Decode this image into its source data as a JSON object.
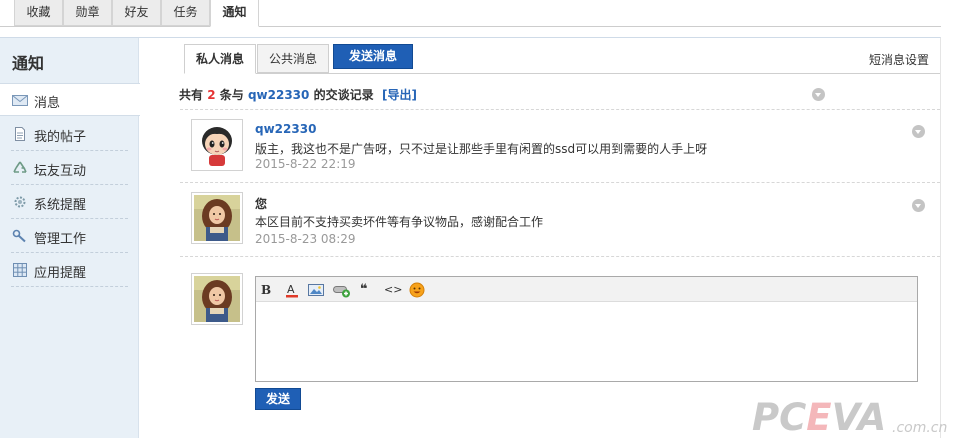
{
  "top_tabs": [
    {
      "label": "收藏"
    },
    {
      "label": "勋章"
    },
    {
      "label": "好友"
    },
    {
      "label": "任务"
    },
    {
      "label": "通知",
      "active": true
    }
  ],
  "sidebar": {
    "title": "通知",
    "items": [
      {
        "label": "消息",
        "icon": "envelope-icon",
        "active": true
      },
      {
        "label": "我的帖子",
        "icon": "document-icon"
      },
      {
        "label": "坛友互动",
        "icon": "recycle-icon"
      },
      {
        "label": "系统提醒",
        "icon": "gear-icon"
      },
      {
        "label": "管理工作",
        "icon": "wrench-icon"
      },
      {
        "label": "应用提醒",
        "icon": "grid-icon"
      }
    ]
  },
  "content_tabs": {
    "private": "私人消息",
    "public": "公共消息",
    "send": "发送消息",
    "settings": "短消息设置"
  },
  "summary": {
    "prefix": "共有",
    "count": "2",
    "middle": "条与",
    "user": "qw22330",
    "suffix": "的交谈记录",
    "export": "[导出]"
  },
  "messages": [
    {
      "name": "qw22330",
      "text": "版主，我这也不是广告呀，只不过是让那些手里有闲置的ssd可以用到需要的人手上呀",
      "time": "2015-8-22 22:19",
      "avatar": "cartoon-boy-avatar"
    },
    {
      "name": "您",
      "text": "本区目前不支持买卖坏件等有争议物品，感谢配合工作",
      "time": "2015-8-23 08:29",
      "avatar": "girl-photo-avatar"
    }
  ],
  "editor": {
    "toolbar": [
      "bold-icon",
      "font-color-icon",
      "image-icon",
      "link-icon",
      "quote-icon",
      "code-icon",
      "smiley-icon"
    ],
    "bold_label": "B",
    "quote_label": "❝",
    "code_label": "<>",
    "value": ""
  },
  "reply": {
    "send_label": "发送"
  },
  "watermark": {
    "brand": "PCEVA",
    "domain": ".com.cn"
  },
  "colors": {
    "accent": "#1f5fb5",
    "link": "#2766b7",
    "highlight": "#e53333",
    "sidebar_bg": "#e8f0f7"
  }
}
